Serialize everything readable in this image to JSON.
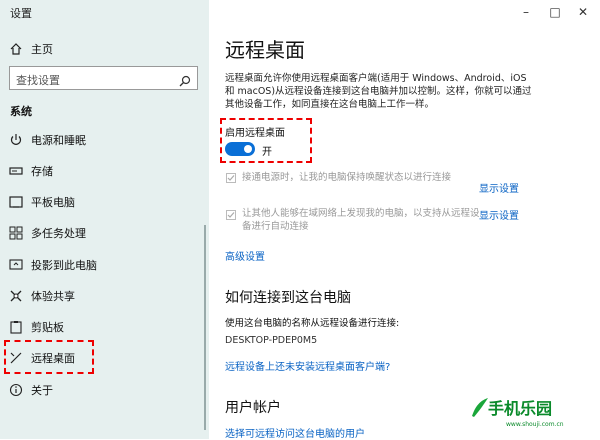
{
  "window": {
    "title": "设置",
    "minimize": "–",
    "maximize": "□",
    "close": "✕"
  },
  "sidebar": {
    "home": "主页",
    "search_placeholder": "查找设置",
    "category": "系统",
    "items": [
      {
        "label": "电源和睡眠",
        "icon": "power-icon"
      },
      {
        "label": "存储",
        "icon": "storage-icon"
      },
      {
        "label": "平板电脑",
        "icon": "tablet-icon"
      },
      {
        "label": "多任务处理",
        "icon": "multitask-icon"
      },
      {
        "label": "投影到此电脑",
        "icon": "project-icon"
      },
      {
        "label": "体验共享",
        "icon": "share-icon"
      },
      {
        "label": "剪贴板",
        "icon": "clipboard-icon"
      },
      {
        "label": "远程桌面",
        "icon": "remote-desktop-icon"
      },
      {
        "label": "关于",
        "icon": "info-icon"
      }
    ]
  },
  "main": {
    "title": "远程桌面",
    "description_line1": "远程桌面允许你使用远程桌面客户端(适用于 Windows、Android、iOS",
    "description_line2": "和 macOS)从远程设备连接到这台电脑并加以控制。这样，你就可以通过",
    "description_line3": "其他设备工作，如同直接在这台电脑上工作一样。",
    "enable_label": "启用远程桌面",
    "toggle_state": "开",
    "option1_text": "接通电源时，让我的电脑保持唤醒状态以进行连接",
    "option1_link": "显示设置",
    "option2_line1": "让其他人能够在域网络上发现我的电脑，以支持从远程设",
    "option2_line2": "备进行自动连接",
    "option2_link": "显示设置",
    "advanced": "高级设置",
    "connect_heading": "如何连接到这台电脑",
    "connect_desc": "使用这台电脑的名称从远程设备进行连接:",
    "pc_name": "DESKTOP-PDEP0M5",
    "no_client_link": "远程设备上还未安装远程桌面客户端?",
    "user_heading": "用户帐户",
    "user_link": "选择可远程访问这台电脑的用户"
  },
  "watermark": {
    "text": "手机乐园",
    "sub": "www.shouji.com.cn"
  }
}
